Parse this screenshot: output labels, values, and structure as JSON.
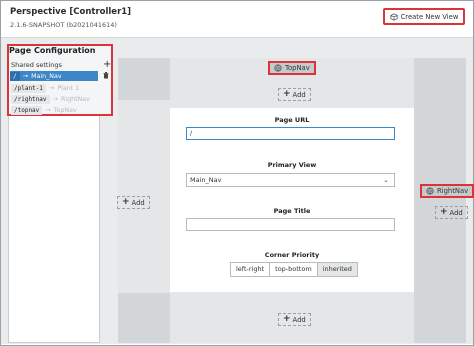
{
  "header": {
    "title": "Perspective [Controller1]",
    "version": "2.1.6-SNAPSHOT (b2021041614)",
    "create_view_label": "Create New View"
  },
  "page_configuration": {
    "title": "Page Configuration",
    "shared_settings": "Shared settings",
    "add_icon": "plus-icon",
    "delete_icon": "trash-icon",
    "routes": [
      {
        "path": "/",
        "arrow": "→",
        "view": "Main_Nav",
        "selected": true
      },
      {
        "path": "/plant-1",
        "arrow": "→",
        "view": "Plant 1",
        "selected": false
      },
      {
        "path": "/rightnav",
        "arrow": "→",
        "view": "RightNav",
        "selected": false
      },
      {
        "path": "/topnav",
        "arrow": "→",
        "view": "TopNav",
        "selected": false
      }
    ]
  },
  "docks": {
    "top": {
      "label": "TopNav",
      "add_label": "Add"
    },
    "right": {
      "label": "RightNav",
      "add_label": "Add"
    },
    "left": {
      "add_label": "Add"
    },
    "bottom": {
      "add_label": "Add"
    }
  },
  "form": {
    "page_url_label": "Page URL",
    "page_url_value": "/",
    "primary_view_label": "Primary View",
    "primary_view_value": "Main_Nav",
    "page_title_label": "Page Title",
    "page_title_value": "",
    "corner_priority_label": "Corner Priority",
    "corner_options": [
      "left-right",
      "top-bottom",
      "inherited"
    ],
    "corner_selected": "inherited"
  },
  "colors": {
    "highlight": "#d9343a",
    "selected_row": "#3f86c7"
  }
}
